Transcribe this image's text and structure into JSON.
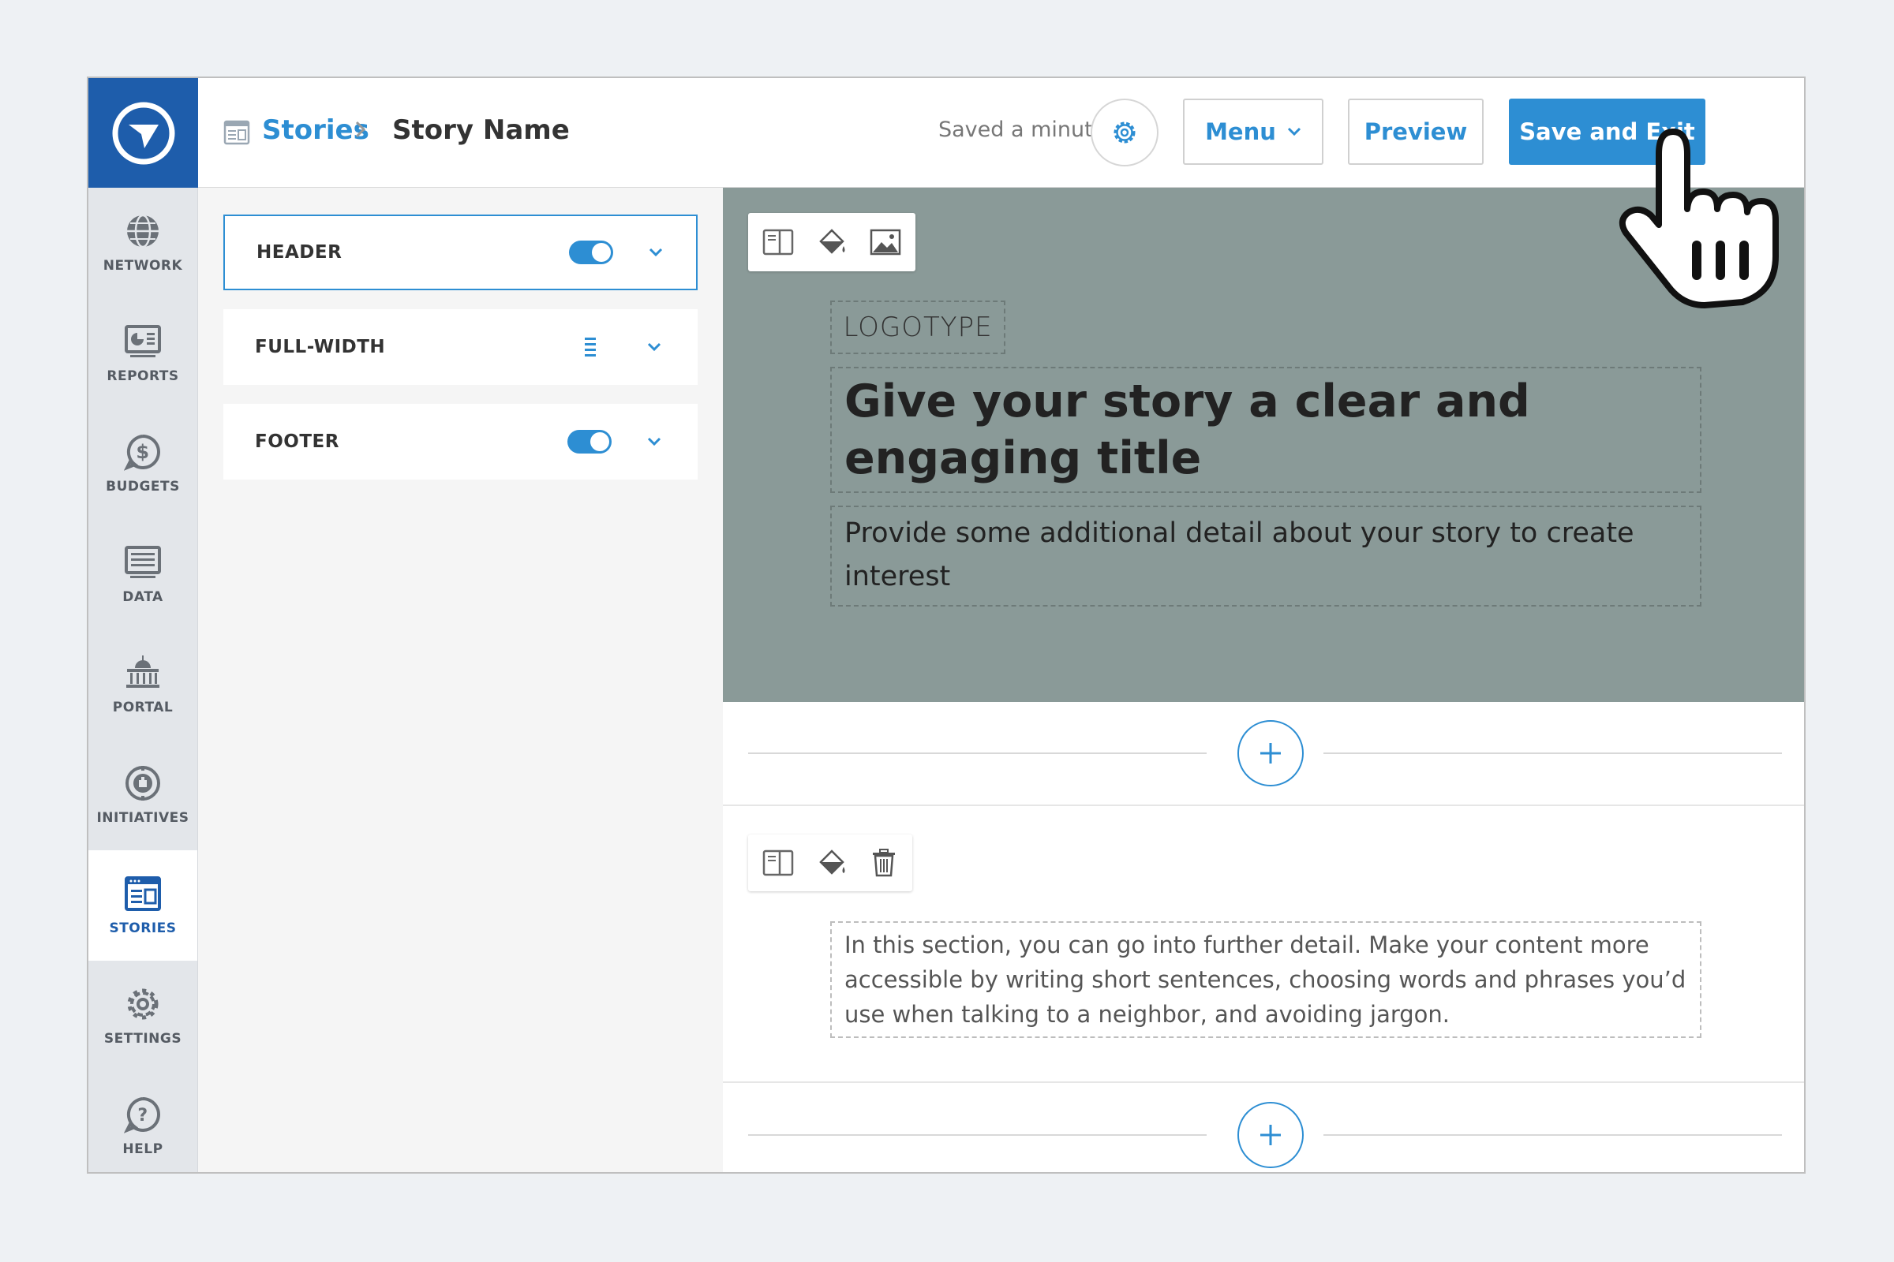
{
  "nav": {
    "items": [
      {
        "label": "NETWORK",
        "icon": "globe-icon"
      },
      {
        "label": "REPORTS",
        "icon": "reports-icon"
      },
      {
        "label": "BUDGETS",
        "icon": "dollar-icon"
      },
      {
        "label": "DATA",
        "icon": "data-icon"
      },
      {
        "label": "PORTAL",
        "icon": "portal-icon"
      },
      {
        "label": "INITIATIVES",
        "icon": "initiatives-icon"
      },
      {
        "label": "STORIES",
        "icon": "stories-icon",
        "active": true
      },
      {
        "label": "SETTINGS",
        "icon": "gear-icon"
      },
      {
        "label": "HELP",
        "icon": "help-icon"
      }
    ]
  },
  "header": {
    "breadcrumb_root": "Stories",
    "breadcrumb_current": "Story Name",
    "saved_status": "Saved a minute ago",
    "menu_label": "Menu",
    "preview_label": "Preview",
    "save_exit_label": "Save and Exit"
  },
  "sections": [
    {
      "label": "HEADER",
      "control": "toggle",
      "enabled": true,
      "selected": true
    },
    {
      "label": "FULL-WIDTH",
      "control": "drag-handle",
      "selected": false
    },
    {
      "label": "FOOTER",
      "control": "toggle",
      "enabled": true,
      "selected": false
    }
  ],
  "hero": {
    "logotype": "LOGOTYPE",
    "title": "Give your story a clear and engaging title",
    "subtitle": "Provide some additional detail about your story to create interest",
    "background": "#8a9a98"
  },
  "content": {
    "paragraph": "In this section, you can go into further detail. Make your content more accessible by writing short sentences, choosing words and phrases you’d use when talking to a neighbor, and avoiding jargon."
  },
  "colors": {
    "accent": "#2d8ed3",
    "brand": "#1e5dab"
  }
}
